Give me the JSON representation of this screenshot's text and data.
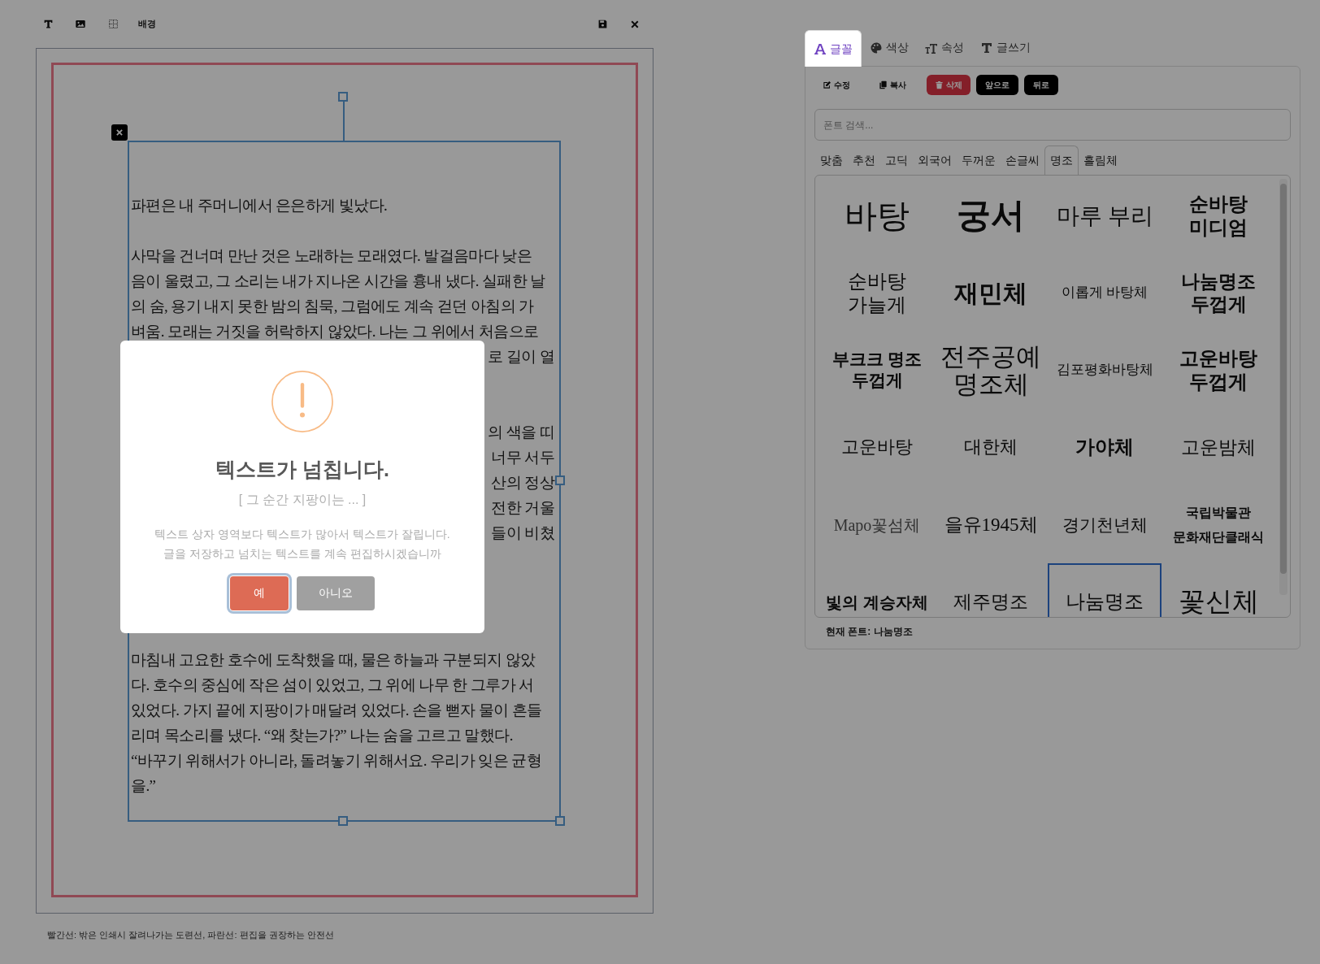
{
  "toolbar": {
    "background_button": "배경"
  },
  "canvas": {
    "paragraphs": [
      {
        "lines": [
          {
            "text": "파편은 내 주머니에서 은은하게 빛났다.",
            "partial": false
          }
        ]
      },
      {
        "lines": [
          {
            "text": "사막을 건너며 만난 것은 노래하는 모래였다. 발걸음마다 낮은",
            "partial": false
          },
          {
            "text": "음이 울렸고, 그 소리는 내가 지나온 시간을 흉내 냈다. 실패한 날",
            "partial": false
          },
          {
            "text": "의 숨, 용기 내지 못한 밤의 침묵, 그럼에도 계속 걷던 아침의 가",
            "partial": false
          },
          {
            "text": "벼움. 모래는 거짓을 허락하지 않았다. 나는 그 위에서 처음으로",
            "partial": false
          },
          {
            "text": "로 길이 열",
            "partial": true
          }
        ]
      },
      {
        "lines": [
          {
            "text": "의 색을 띠",
            "partial": true
          },
          {
            "text": "너무 서두",
            "partial": true
          },
          {
            "text": "산의 정상",
            "partial": true
          },
          {
            "text": "전한 거울",
            "partial": true
          },
          {
            "text": "들이 비쳤",
            "partial": true
          }
        ]
      },
      {
        "lines": [
          {
            "text": "마침내 고요한 호수에 도착했을 때, 물은 하늘과 구분되지 않았",
            "partial": false
          },
          {
            "text": "다. 호수의 중심에 작은 섬이 있었고, 그 위에 나무 한 그루가 서",
            "partial": false
          },
          {
            "text": "있었다. 가지 끝에 지팡이가 매달려 있었다. 손을 뻗자 물이 흔들",
            "partial": false
          },
          {
            "text": "리며 목소리를 냈다. “왜 찾는가?” 나는 숨을 고르고 말했다.",
            "partial": false
          },
          {
            "text": "“바꾸기 위해서가 아니라, 돌려놓기 위해서요. 우리가 잊은 균형",
            "partial": false
          },
          {
            "text": "을.”",
            "partial": false
          }
        ]
      }
    ]
  },
  "legend": "빨간선: 밖은 인쇄시 잘려나가는 도련선, 파란선: 편집을 권장하는 안전선",
  "panel": {
    "tabs": [
      {
        "label": "글꼴",
        "kind": "font",
        "selected": true
      },
      {
        "label": "색상",
        "kind": "color",
        "selected": false
      },
      {
        "label": "속성",
        "kind": "size",
        "selected": false
      },
      {
        "label": "글쓰기",
        "kind": "write",
        "selected": false
      }
    ],
    "actions": [
      {
        "label": "수정",
        "kind": "edit"
      },
      {
        "label": "복사",
        "kind": "copy"
      },
      {
        "label": "삭제",
        "kind": "delete"
      },
      {
        "label": "앞으로",
        "kind": "front"
      },
      {
        "label": "뒤로",
        "kind": "back"
      }
    ],
    "search": {
      "placeholder": "폰트 검색..."
    },
    "categories": [
      {
        "label": "맞춤",
        "selected": false
      },
      {
        "label": "추천",
        "selected": false
      },
      {
        "label": "고딕",
        "selected": false
      },
      {
        "label": "외국어",
        "selected": false
      },
      {
        "label": "두꺼운",
        "selected": false
      },
      {
        "label": "손글씨",
        "selected": false
      },
      {
        "label": "명조",
        "selected": true
      },
      {
        "label": "흘림체",
        "selected": false
      }
    ],
    "fonts": [
      {
        "label": "바탕",
        "selected": false
      },
      {
        "label": "궁서",
        "selected": false
      },
      {
        "label": "마루 부리",
        "selected": false
      },
      {
        "label": "순바탕 미디엄",
        "selected": false
      },
      {
        "label": "순바탕 가늘게",
        "selected": false
      },
      {
        "label": "재민체",
        "selected": false
      },
      {
        "label": "이롭게 바탕체",
        "selected": false
      },
      {
        "label": "나눔명조 두껍게",
        "selected": false
      },
      {
        "label": "부크크 명조 두껍게",
        "selected": false
      },
      {
        "label": "전주공예 명조체",
        "selected": false
      },
      {
        "label": "김포평화바탕체",
        "selected": false
      },
      {
        "label": "고운바탕 두껍게",
        "selected": false
      },
      {
        "label": "고운바탕",
        "selected": false
      },
      {
        "label": "대한체",
        "selected": false
      },
      {
        "label": "가야체",
        "selected": false
      },
      {
        "label": "고운밤체",
        "selected": false
      },
      {
        "label": "Mapo꽃섬체",
        "selected": false
      },
      {
        "label": "을유1945체",
        "selected": false
      },
      {
        "label": "경기천년체",
        "selected": false
      },
      {
        "label": "국립박물관 문화재단클래식",
        "selected": false
      },
      {
        "label": "빛의 계승자체",
        "selected": false
      },
      {
        "label": "제주명조",
        "selected": false
      },
      {
        "label": "나눔명조",
        "selected": true
      },
      {
        "label": "꽃신체",
        "selected": false
      }
    ],
    "current_font": "현재 폰트: 나눔명조"
  },
  "dialog": {
    "title": "텍스트가 넘칩니다.",
    "subtitle": "[ 그 순간 지팡이는 ... ]",
    "message_lines": [
      "텍스트 상자 영역보다 텍스트가 많아서 텍스트가 잘립니다.",
      "글을 저장하고 넘치는 텍스트를 계속 편집하시겠습니까"
    ],
    "buttons": [
      {
        "label": "예",
        "kind": "confirm",
        "focused": true
      },
      {
        "label": "아니오",
        "kind": "cancel",
        "focused": false
      }
    ]
  }
}
